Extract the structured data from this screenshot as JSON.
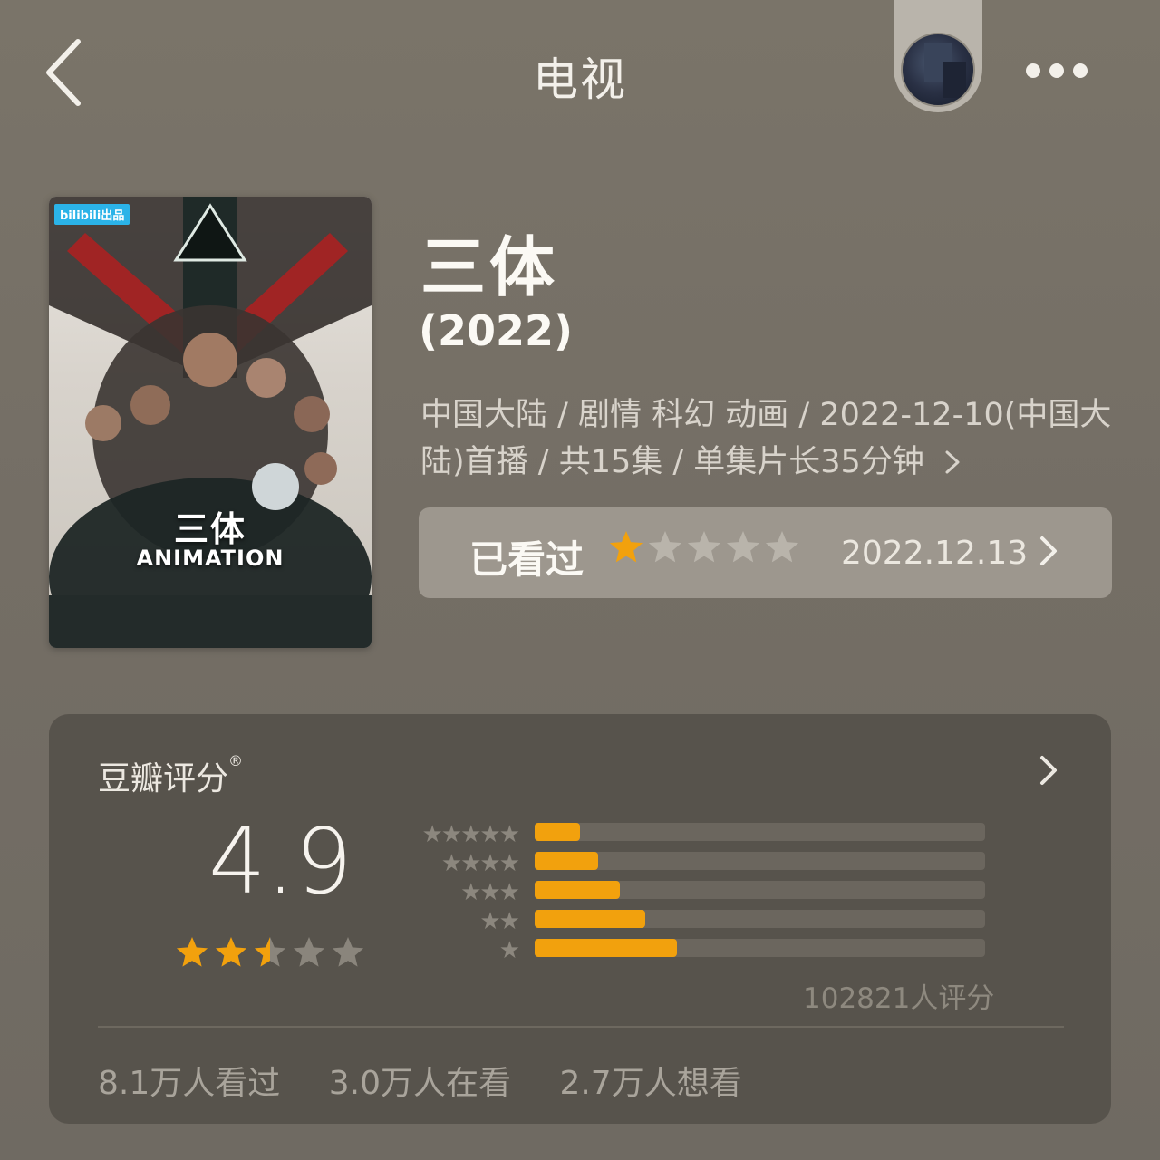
{
  "header": {
    "title": "电视"
  },
  "poster": {
    "brand_label": "bilibili出品",
    "title": "三体",
    "subtitle": "ANIMATION"
  },
  "show": {
    "title": "三体",
    "year": "(2022)",
    "meta": "中国大陆 / 剧情 科幻 动画 / 2022-12-10(中国大陆)首播 / 共15集 / 单集片长35分钟"
  },
  "status": {
    "label": "已看过",
    "my_rating_stars": 1,
    "date": "2022.12.13",
    "star_color": "#f2a10d"
  },
  "douban": {
    "label": "豆瓣评分",
    "mark": "®",
    "score": "4.9",
    "score_stars": 2.5,
    "distribution": [
      {
        "stars": 5,
        "fraction": 0.1
      },
      {
        "stars": 4,
        "fraction": 0.14
      },
      {
        "stars": 3,
        "fraction": 0.19
      },
      {
        "stars": 2,
        "fraction": 0.245
      },
      {
        "stars": 1,
        "fraction": 0.315
      }
    ],
    "rating_count": "102821人评分",
    "accent": "#f2a10d"
  },
  "stats": {
    "watched": "8.1万人看过",
    "watching": "3.0万人在看",
    "wish": "2.7万人想看"
  }
}
